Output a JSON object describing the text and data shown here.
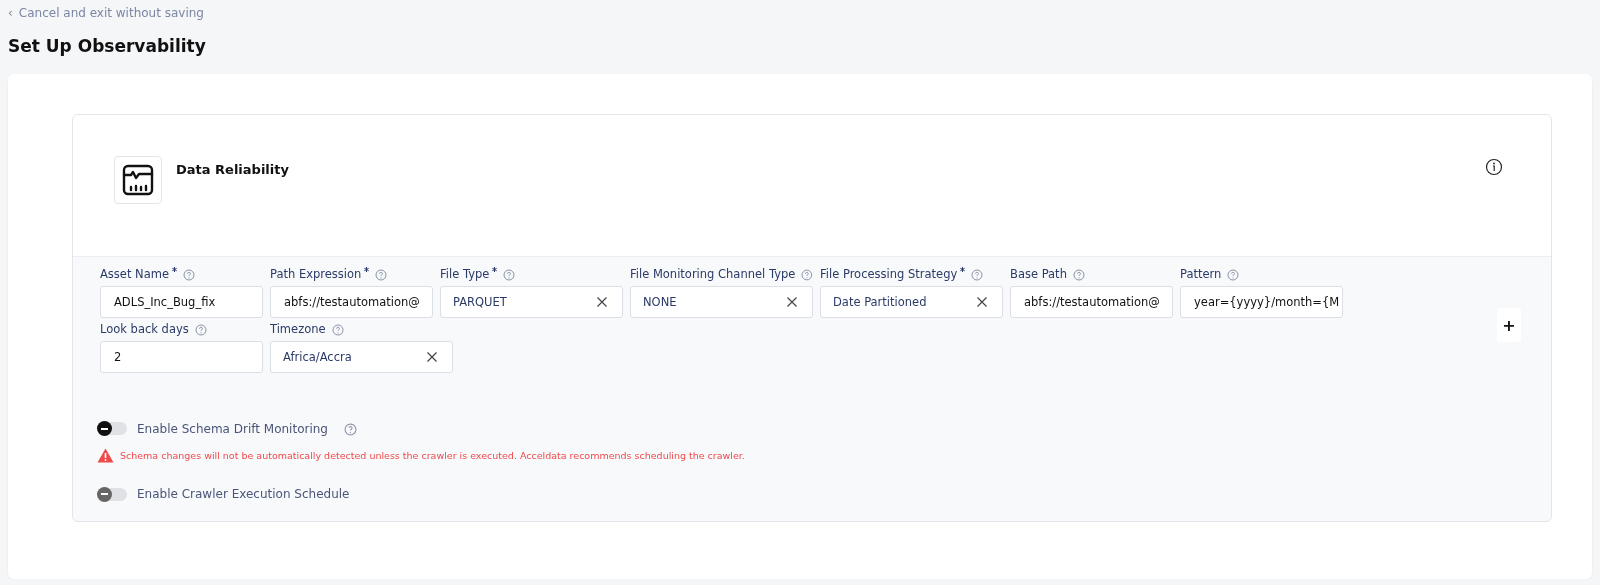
{
  "back_link": {
    "icon": "‹",
    "label": "Cancel and exit without saving"
  },
  "title": "Set Up Observability",
  "panel": {
    "title": "Data Reliability"
  },
  "form_rows": [
    [
      {
        "label": "Asset Name",
        "required": true,
        "kind": "text",
        "value": "ADLS_Inc_Bug_fix"
      },
      {
        "label": "Path Expression",
        "required": true,
        "kind": "text",
        "value": "abfs://testautomation@"
      },
      {
        "label": "File Type",
        "required": true,
        "kind": "select",
        "value": "PARQUET"
      },
      {
        "label": "File Monitoring Channel Type",
        "required": false,
        "kind": "select",
        "value": "NONE"
      },
      {
        "label": "File Processing Strategy",
        "required": true,
        "kind": "select",
        "value": "Date Partitioned"
      },
      {
        "label": "Base Path",
        "required": false,
        "kind": "text",
        "value": "abfs://testautomation@"
      },
      {
        "label": "Pattern",
        "required": false,
        "kind": "text",
        "value": "year={yyyy}/month={M"
      }
    ],
    [
      {
        "label": "Look back days",
        "required": false,
        "kind": "text",
        "value": "2"
      },
      {
        "label": "Timezone",
        "required": false,
        "kind": "select",
        "value": "Africa/Accra"
      }
    ]
  ],
  "add_button": {
    "label": "+"
  },
  "toggles": [
    {
      "label": "Enable Schema Drift Monitoring",
      "on": false,
      "disabled": false,
      "help": true,
      "warning": "Schema changes will not be automatically detected unless the crawler is executed. Acceldata recommends scheduling the crawler."
    },
    {
      "label": "Enable Crawler Execution Schedule",
      "on": false,
      "disabled": true,
      "help": false
    }
  ]
}
